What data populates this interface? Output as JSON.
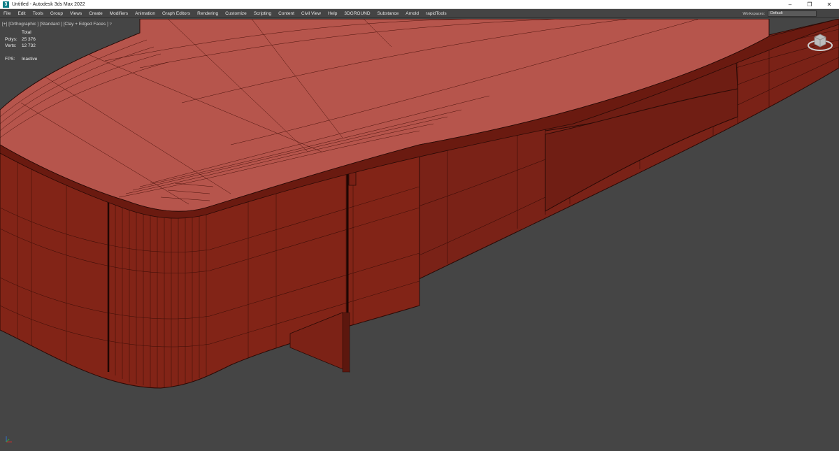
{
  "window": {
    "title": "Untitled - Autodesk 3ds Max 2022",
    "app_icon": "3"
  },
  "window_controls": [
    "–",
    "❐",
    "✕"
  ],
  "menu": [
    "File",
    "Edit",
    "Tools",
    "Group",
    "Views",
    "Create",
    "Modifiers",
    "Animation",
    "Graph Editors",
    "Rendering",
    "Customize",
    "Scripting",
    "Content",
    "Civil View",
    "Help",
    "3DGROUND",
    "Substance",
    "Arnold",
    "rapidTools"
  ],
  "workspace": {
    "label": "Workspaces:",
    "value": "Default"
  },
  "viewport": {
    "label": "[+] [Orthographic ] [Standard ] [Clay + Edged Faces ]",
    "filter_icon": "funnel-icon",
    "stats": {
      "header": "Total",
      "polys_label": "Polys:",
      "polys": "25 376",
      "verts_label": "Verts:",
      "verts": "12 732",
      "fps_label": "FPS:",
      "fps": "Inactive"
    }
  },
  "colors": {
    "viewport_bg": "#454545",
    "clay_top": "#b5554d",
    "clay_side": "#7e2318",
    "clay_dark": "#651a11",
    "wire": "#2a0a06"
  }
}
